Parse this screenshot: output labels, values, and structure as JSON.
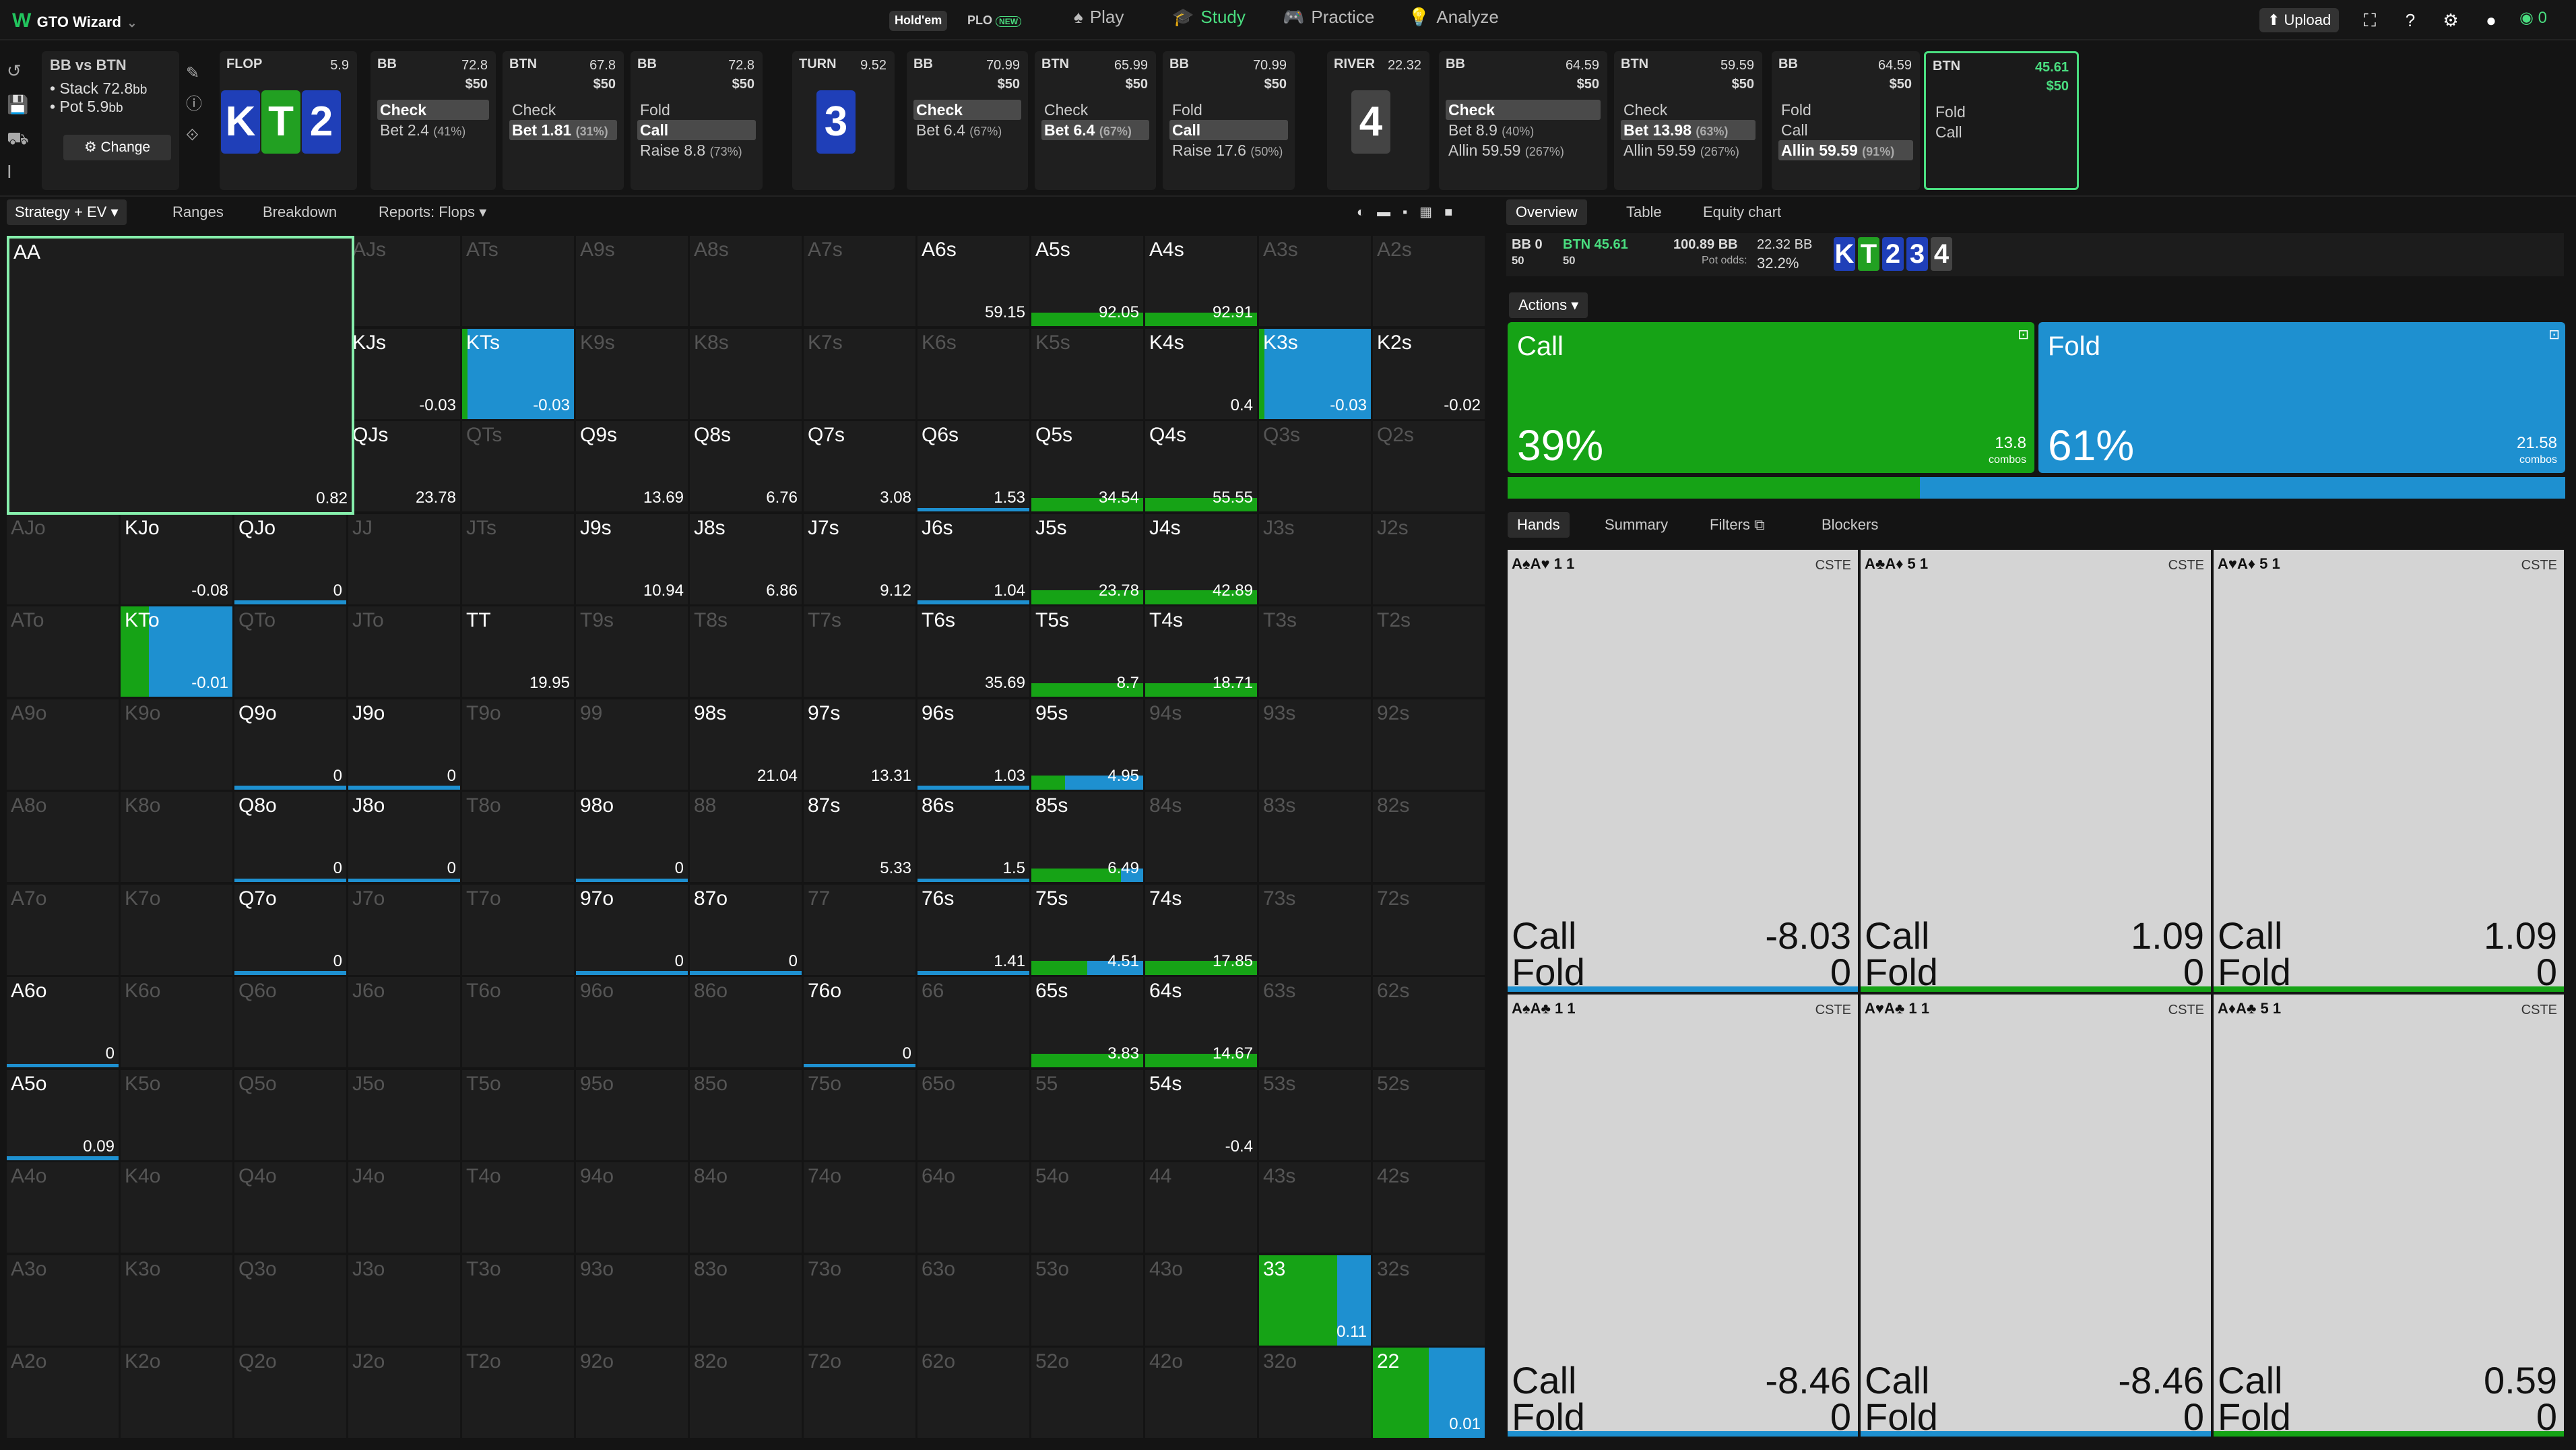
{
  "app": {
    "name": "GTO Wizard",
    "mode_holdem": "Hold'em",
    "mode_plo": "PLO",
    "plo_badge": "NEW"
  },
  "nav": [
    {
      "label": "Play",
      "icon": "play-icon"
    },
    {
      "label": "Study",
      "icon": "study-icon"
    },
    {
      "label": "Practice",
      "icon": "practice-icon"
    },
    {
      "label": "Analyze",
      "icon": "analyze-icon"
    }
  ],
  "top_right": {
    "upload": "Upload",
    "coins": "0"
  },
  "spot": {
    "title": "BB vs BTN",
    "stack": "Stack 72.8",
    "stack_unit": "bb",
    "pot": "Pot 5.9",
    "pot_unit": "bb",
    "change": "Change"
  },
  "street_nodes": [
    {
      "pos": "FLOP",
      "stack": "5.9",
      "cards": [
        "K",
        "T",
        "2"
      ]
    },
    {
      "pos": "BB",
      "stack": "72.8",
      "pot": "$50",
      "actions": [
        {
          "t": "Check",
          "sel": true
        },
        {
          "t": "Bet 2.4",
          "p": "(41%)"
        }
      ]
    },
    {
      "pos": "BTN",
      "stack": "67.8",
      "pot": "$50",
      "actions": [
        {
          "t": "Check"
        },
        {
          "t": "Bet 1.81",
          "p": "(31%)",
          "sel": true
        }
      ]
    },
    {
      "pos": "BB",
      "stack": "72.8",
      "pot": "$50",
      "actions": [
        {
          "t": "Fold"
        },
        {
          "t": "Call",
          "sel": true
        },
        {
          "t": "Raise 8.8",
          "p": "(73%)"
        }
      ]
    },
    {
      "pos": "TURN",
      "stack": "9.52",
      "cards": [
        "3"
      ]
    },
    {
      "pos": "BB",
      "stack": "70.99",
      "pot": "$50",
      "actions": [
        {
          "t": "Check",
          "sel": true
        },
        {
          "t": "Bet 6.4",
          "p": "(67%)"
        }
      ]
    },
    {
      "pos": "BTN",
      "stack": "65.99",
      "pot": "$50",
      "actions": [
        {
          "t": "Check"
        },
        {
          "t": "Bet 6.4",
          "p": "(67%)",
          "sel": true
        }
      ]
    },
    {
      "pos": "BB",
      "stack": "70.99",
      "pot": "$50",
      "actions": [
        {
          "t": "Fold"
        },
        {
          "t": "Call",
          "sel": true
        },
        {
          "t": "Raise 17.6",
          "p": "(50%)"
        }
      ]
    },
    {
      "pos": "RIVER",
      "stack": "22.32",
      "cards": [
        "4"
      ]
    },
    {
      "pos": "BB",
      "stack": "64.59",
      "pot": "$50",
      "actions": [
        {
          "t": "Check",
          "sel": true
        },
        {
          "t": "Bet 8.9",
          "p": "(40%)"
        },
        {
          "t": "Allin 59.59",
          "p": "(267%)"
        }
      ]
    },
    {
      "pos": "BTN",
      "stack": "59.59",
      "pot": "$50",
      "actions": [
        {
          "t": "Check"
        },
        {
          "t": "Bet 13.98",
          "p": "(63%)",
          "sel": true
        },
        {
          "t": "Allin 59.59",
          "p": "(267%)"
        }
      ]
    },
    {
      "pos": "BB",
      "stack": "64.59",
      "pot": "$50",
      "actions": [
        {
          "t": "Fold"
        },
        {
          "t": "Call"
        },
        {
          "t": "Allin 59.59",
          "p": "(91%)",
          "sel": true
        }
      ]
    },
    {
      "pos": "BTN",
      "stack": "45.61",
      "pot": "$50",
      "actions": [
        {
          "t": "Fold"
        },
        {
          "t": "Call"
        }
      ]
    }
  ],
  "left_tabs": [
    "Strategy + EV",
    "Ranges",
    "Breakdown",
    "Reports: Flops"
  ],
  "right_tabs": [
    "Overview",
    "Table",
    "Equity chart"
  ],
  "summary": {
    "bb": "BB 0",
    "bb_sub": "50",
    "btn": "BTN 45.61",
    "btn_sub": "50",
    "pot": "100.89 BB",
    "odds_val": "22.32 BB",
    "odds_label": "Pot odds:",
    "odds_pct": "32.2%",
    "board": [
      "K",
      "T",
      "2",
      "3",
      "4"
    ]
  },
  "actions_label": "Actions",
  "actions": [
    {
      "name": "Call",
      "pct": "39%",
      "combos": "13.8",
      "color": "#16a316"
    },
    {
      "name": "Fold",
      "pct": "61%",
      "combos": "21.58",
      "color": "#1e90d0"
    }
  ],
  "combos_label": "combos",
  "hands_tabs": [
    "Hands",
    "Summary",
    "Filters",
    "Blockers"
  ],
  "hands": [
    {
      "tag": "A♠A♥ 1 1",
      "cste": "CSTE",
      "call": "-8.03",
      "fold": "0"
    },
    {
      "tag": "A♣A♦ 5 1",
      "cste": "CSTE",
      "call": "1.09",
      "fold": "0"
    },
    {
      "tag": "A♥A♦ 5 1",
      "cste": "CSTE",
      "call": "1.09",
      "fold": "0"
    },
    {
      "tag": "A♠A♣ 1 1",
      "cste": "CSTE",
      "call": "-8.46",
      "fold": "0"
    },
    {
      "tag": "A♥A♣ 1 1",
      "cste": "CSTE",
      "call": "-8.46",
      "fold": "0"
    },
    {
      "tag": "A♦A♣ 5 1",
      "cste": "CSTE",
      "call": "0.59",
      "fold": "0"
    }
  ],
  "hand_call": "Call",
  "hand_fold": "Fold",
  "grid": {
    "ranks": [
      "A",
      "K",
      "Q",
      "J",
      "T",
      "9",
      "8",
      "7",
      "6",
      "5",
      "4",
      "3",
      "2"
    ],
    "active": {
      "AA": {
        "ev": "0.82",
        "call": 0
      },
      "KTs": {
        "ev": "-0.03",
        "call": 0.05
      },
      "A6s": {
        "ev": "59.15",
        "call": 0
      },
      "A5s": {
        "ev": "92.05",
        "call": 1
      },
      "A4s": {
        "ev": "92.91",
        "call": 1
      },
      "K3s": {
        "ev": "-0.03",
        "call": 0.05
      },
      "KTo": {
        "ev": "-0.01",
        "call": 0.25
      },
      "TT": {
        "ev": "19.95",
        "call": 0
      },
      "33": {
        "ev": "0.11",
        "call": 0.7
      },
      "22": {
        "ev": "0.01",
        "call": 0.5
      },
      "54s": {
        "ev": "-0.4",
        "call": 0
      },
      "65s": {
        "ev": "3.83",
        "call": 1
      },
      "64s": {
        "ev": "14.67",
        "call": 1
      },
      "75s": {
        "ev": "4.51",
        "call": 0.5
      },
      "74s": {
        "ev": "17.85",
        "call": 1
      },
      "T5s": {
        "ev": "8.7",
        "call": 1
      },
      "T4s": {
        "ev": "18.71",
        "call": 1
      },
      "J5s": {
        "ev": "23.78",
        "call": 1
      },
      "J4s": {
        "ev": "42.89",
        "call": 1
      },
      "Q5s": {
        "ev": "34.54",
        "call": 1
      },
      "Q4s": {
        "ev": "55.55",
        "call": 1
      },
      "95s": {
        "ev": "4.95",
        "call": 0.3
      },
      "85s": {
        "ev": "6.49",
        "call": 0.8
      },
      "A6o": {
        "ev": "0",
        "call": 0
      },
      "A5o": {
        "ev": "0.09",
        "call": 0
      },
      "KJs": {
        "ev": "-0.03",
        "call": 0
      },
      "K4s": {
        "ev": "0.4",
        "call": 0
      },
      "K2s": {
        "ev": "-0.02",
        "call": 0
      },
      "QJs": {
        "ev": "23.78",
        "call": 0
      },
      "Q9s": {
        "ev": "13.69",
        "call": 0
      },
      "Q8s": {
        "ev": "6.76",
        "call": 0
      },
      "Q7s": {
        "ev": "3.08",
        "call": 0
      },
      "Q6s": {
        "ev": "1.53",
        "call": 0
      },
      "KJo": {
        "ev": "-0.08",
        "call": 0
      },
      "QJo": {
        "ev": "0",
        "call": 0
      },
      "J9s": {
        "ev": "10.94",
        "call": 0
      },
      "J8s": {
        "ev": "6.86",
        "call": 0
      },
      "J7s": {
        "ev": "9.12",
        "call": 0
      },
      "J6s": {
        "ev": "1.04",
        "call": 0
      },
      "T6s": {
        "ev": "35.69",
        "call": 0
      },
      "Q9o": {
        "ev": "0",
        "call": 0
      },
      "J9o": {
        "ev": "0",
        "call": 0
      },
      "98s": {
        "ev": "21.04",
        "call": 0
      },
      "97s": {
        "ev": "13.31",
        "call": 0
      },
      "96s": {
        "ev": "1.03",
        "call": 0
      },
      "Q8o": {
        "ev": "0",
        "call": 0
      },
      "J8o": {
        "ev": "0",
        "call": 0
      },
      "98o": {
        "ev": "0",
        "call": 0
      },
      "87s": {
        "ev": "5.33",
        "call": 0
      },
      "86s": {
        "ev": "1.5",
        "call": 0
      },
      "Q7o": {
        "ev": "0",
        "call": 0
      },
      "97o": {
        "ev": "0",
        "call": 0
      },
      "87o": {
        "ev": "0",
        "call": 0
      },
      "76s": {
        "ev": "1.41",
        "call": 0
      },
      "76o": {
        "ev": "0",
        "call": 0
      }
    }
  }
}
